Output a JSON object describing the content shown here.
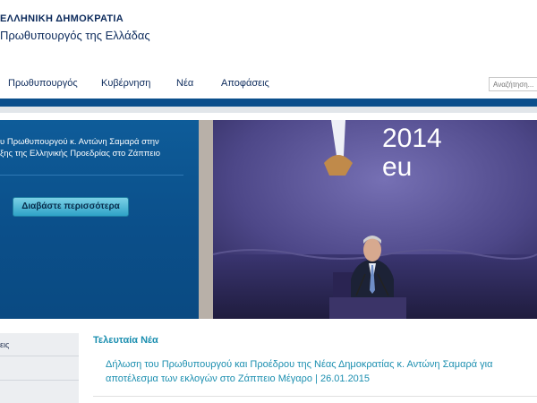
{
  "header": {
    "country": "ΕΛΛΗΝΙΚΗ ΔΗΜΟΚΡΑΤΙΑ",
    "office": "Πρωθυπουργός της Ελλάδας"
  },
  "nav": {
    "items": [
      "Πρωθυπουργός",
      "Κυβέρνηση",
      "Νέα",
      "Αποφάσεις"
    ],
    "search_placeholder": "Αναζήτηση..."
  },
  "hero": {
    "headline_line1": "υ Πρωθυπουργού κ. Αντώνη Σαμαρά στην",
    "headline_line2": "ξης της Ελληνικής Προεδρίας στο Ζάππειο",
    "read_more_label": "Διαβάστε περισσότερα",
    "photo_sign_text1": "2014",
    "photo_sign_text2": "eu"
  },
  "sidebar": {
    "items": [
      "εις",
      "",
      ""
    ]
  },
  "news": {
    "section_title": "Τελευταία Νέα",
    "items": [
      {
        "line1": "Δήλωση του Πρωθυπουργού και Προέδρου της Νέας Δημοκρατίας κ. Αντώνη Σαμαρά για",
        "line2": "αποτέλεσμα των εκλογών στο Ζάππειο Μέγαρο | 26.01.2015"
      }
    ]
  },
  "colors": {
    "brand_blue": "#0b4f8c",
    "link_teal": "#1c8fb0",
    "nav_text": "#0d2b5c"
  }
}
